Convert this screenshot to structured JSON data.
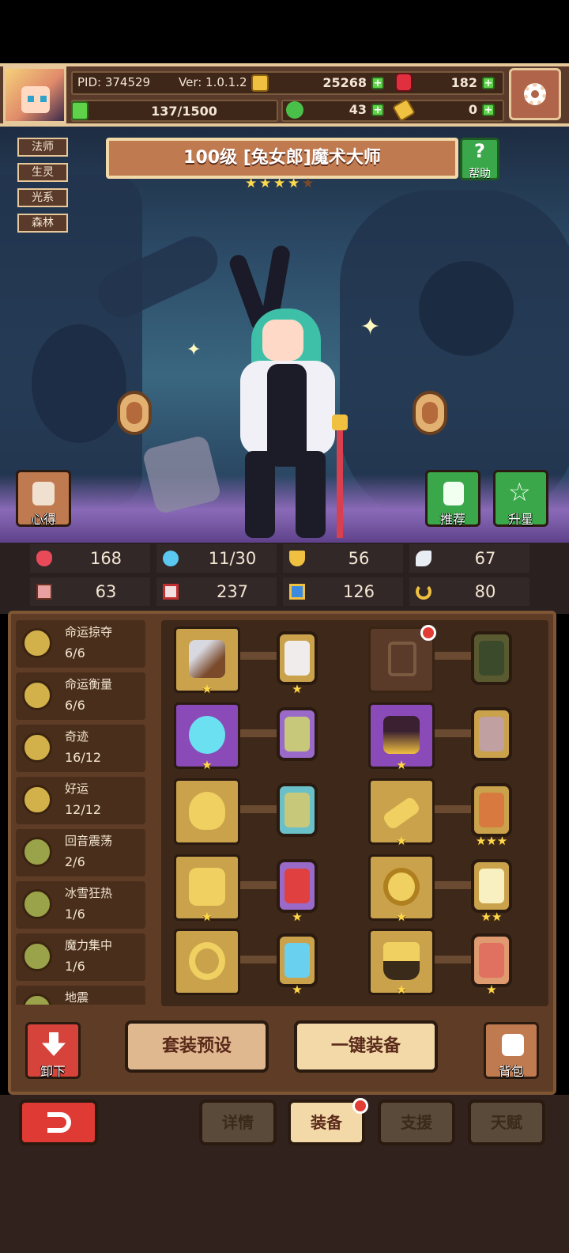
{
  "header": {
    "pid_label": "PID: 374529",
    "version_label": "Ver: 1.0.1.2",
    "gold": "25268",
    "ruby": "182",
    "stamina": "137/1500",
    "clover": "43",
    "key": "0"
  },
  "tags": [
    "法师",
    "生灵",
    "光系",
    "森林"
  ],
  "character": {
    "title": "100级 [兔女郎]魔术大师",
    "stars": 4,
    "max_stars": 5,
    "help_label": "帮助"
  },
  "side_buttons": {
    "notes": "心得",
    "recommend": "推荐",
    "star_up": "升星"
  },
  "stats": [
    {
      "icon": "heart-icon",
      "value": "168"
    },
    {
      "icon": "mana-drop-icon",
      "value": "11/30"
    },
    {
      "icon": "shield-icon",
      "value": "56"
    },
    {
      "icon": "wing-icon",
      "value": "67"
    },
    {
      "icon": "fist-icon",
      "value": "63"
    },
    {
      "icon": "spellbook-icon",
      "value": "237"
    },
    {
      "icon": "magic-scroll-icon",
      "value": "126"
    },
    {
      "icon": "horseshoe-icon",
      "value": "80"
    }
  ],
  "sets": [
    {
      "name": "命运掠夺",
      "progress": "6/6"
    },
    {
      "name": "命运衡量",
      "progress": "6/6"
    },
    {
      "name": "奇迹",
      "progress": "16/12"
    },
    {
      "name": "好运",
      "progress": "12/12"
    },
    {
      "name": "回音震荡",
      "progress": "2/6"
    },
    {
      "name": "冰雪狂热",
      "progress": "1/6"
    },
    {
      "name": "魔力集中",
      "progress": "1/6"
    },
    {
      "name": "地震",
      "progress": ""
    }
  ],
  "equipment_rows": [
    {
      "left_item": "hammer-icon",
      "left_rank": "★",
      "left_gem": "silver-gem",
      "left_gem_rank": "★",
      "right_item": "empty-slot",
      "right_rank": "",
      "right_gem": "dark-gem",
      "right_gem_rank": ""
    },
    {
      "left_item": "orb-icon",
      "left_rank": "★",
      "left_gem": "green-gem",
      "left_gem_rank": "",
      "right_item": "bat-armor-icon",
      "right_rank": "★",
      "right_gem": "pink-gem",
      "right_gem_rank": ""
    },
    {
      "left_item": "necklace-icon",
      "left_rank": "",
      "left_gem": "teal-gem",
      "left_gem_rank": "",
      "right_item": "bone-icon",
      "right_rank": "★",
      "right_gem": "orange-gem",
      "right_gem_rank": "★★★"
    },
    {
      "left_item": "brooch-icon",
      "left_rank": "★",
      "left_gem": "red-gem",
      "left_gem_rank": "★",
      "right_item": "crown-icon",
      "right_rank": "★",
      "right_gem": "gold-gem",
      "right_gem_rank": "★★"
    },
    {
      "left_item": "ring-icon",
      "left_rank": "",
      "left_gem": "blue-gem",
      "left_gem_rank": "★",
      "right_item": "boots-icon",
      "right_rank": "★",
      "right_gem": "coral-gem",
      "right_gem_rank": "★"
    }
  ],
  "actions": {
    "unequip": "卸下",
    "preset": "套装预设",
    "auto_equip": "一键装备",
    "bag": "背包"
  },
  "tabs": {
    "details": "详情",
    "equipment": "装备",
    "support": "支援",
    "talent": "天赋"
  },
  "colors": {
    "brown_frame": "#5e3c26",
    "gold_accent": "#e6c89a",
    "plus_green": "#5fd24a",
    "alert_red": "#e23c34"
  }
}
